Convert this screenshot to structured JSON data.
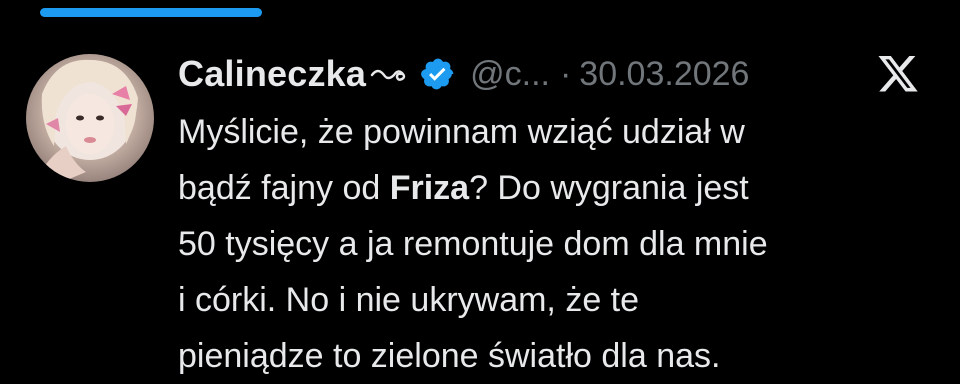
{
  "tweet": {
    "author": {
      "display_name": "Calineczka",
      "handle": "@c...",
      "verified": true
    },
    "separator": "·",
    "date": "30.03.2026",
    "text_lines": [
      {
        "parts": [
          {
            "text": "Myślicie, że powinnam wziąć udział w",
            "bold": false
          }
        ]
      },
      {
        "parts": [
          {
            "text": "bądź fajny od ",
            "bold": false
          },
          {
            "text": "Friza",
            "bold": true
          },
          {
            "text": "? Do wygrania jest",
            "bold": false
          }
        ]
      },
      {
        "parts": [
          {
            "text": "50 tysięcy a ja remontuje dom dla mnie",
            "bold": false
          }
        ]
      },
      {
        "parts": [
          {
            "text": "i córki. No i nie ukrywam, że te",
            "bold": false
          }
        ]
      },
      {
        "parts": [
          {
            "text": "pieniądze to zielone światło dla nas.",
            "bold": false
          }
        ]
      }
    ]
  },
  "icons": {
    "verified_badge": "verified-badge-icon",
    "name_decoration": "swirl-icon",
    "platform_logo": "x-logo-icon"
  },
  "colors": {
    "background": "#000000",
    "primary_text": "#e7e9ea",
    "secondary_text": "#71767b",
    "accent": "#1d9bf0"
  }
}
